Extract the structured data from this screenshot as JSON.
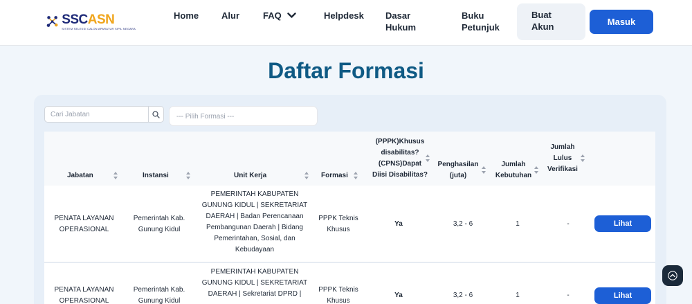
{
  "brand": {
    "part1": "SSC",
    "part2": "ASN",
    "tagline": "SISTEM SELEKSI CALON APARATUR SIPIL NEGARA"
  },
  "nav": {
    "home": "Home",
    "alur": "Alur",
    "faq": "FAQ",
    "helpdesk": "Helpdesk",
    "dasar_hukum_1": "Dasar",
    "dasar_hukum_2": "Hukum",
    "buku_petunjuk_1": "Buku",
    "buku_petunjuk_2": "Petunjuk",
    "buat_akun_1": "Buat",
    "buat_akun_2": "Akun",
    "masuk": "Masuk"
  },
  "page_title": "Daftar Formasi",
  "filters": {
    "search_placeholder": "Cari Jabatan",
    "formasi_placeholder": "--- Pilih Formasi ---"
  },
  "table": {
    "headers": {
      "jabatan": "Jabatan",
      "instansi": "Instansi",
      "unit_kerja": "Unit Kerja",
      "formasi": "Formasi",
      "disabilitas_1": "(PPPK)Khusus",
      "disabilitas_2": "disabilitas?",
      "disabilitas_3": "(CPNS)Dapat",
      "disabilitas_4": "Diisi Disabilitas?",
      "penghasilan_1": "Penghasilan",
      "penghasilan_2": "(juta)",
      "kebutuhan_1": "Jumlah",
      "kebutuhan_2": "Kebutuhan",
      "lulus_1": "Jumlah",
      "lulus_2": "Lulus",
      "lulus_3": "Verifikasi"
    },
    "rows": [
      {
        "jabatan_1": "PENATA LAYANAN",
        "jabatan_2": "OPERASIONAL",
        "instansi_1": "Pemerintah Kab.",
        "instansi_2": "Gunung Kidul",
        "unit_1": "PEMERINTAH KABUPATEN",
        "unit_2": "GUNUNG KIDUL | SEKRETARIAT",
        "unit_3": "DAERAH | Badan Perencanaan",
        "unit_4": "Pembangunan Daerah | Bidang",
        "unit_5": "Pemerintahan, Sosial, dan",
        "unit_6": "Kebudayaan",
        "formasi_1": "PPPK Teknis",
        "formasi_2": "Khusus",
        "disabilitas": "Ya",
        "penghasilan": "3,2 - 6",
        "kebutuhan": "1",
        "lulus": "-",
        "action": "Lihat"
      },
      {
        "jabatan_1": "PENATA LAYANAN",
        "jabatan_2": "OPERASIONAL",
        "instansi_1": "Pemerintah Kab.",
        "instansi_2": "Gunung Kidul",
        "unit_1": "PEMERINTAH KABUPATEN",
        "unit_2": "GUNUNG KIDUL | SEKRETARIAT",
        "unit_3": "DAERAH | Sekretariat DPRD |",
        "formasi_1": "PPPK Teknis",
        "formasi_2": "Khusus",
        "disabilitas": "Ya",
        "penghasilan": "3,2 - 6",
        "kebutuhan": "1",
        "lulus": "-",
        "action": "Lihat"
      }
    ]
  },
  "colors": {
    "primary": "#1d5fd6",
    "title": "#0f5a84",
    "brand_navy": "#1e2a78",
    "brand_orange": "#f0a51c"
  }
}
